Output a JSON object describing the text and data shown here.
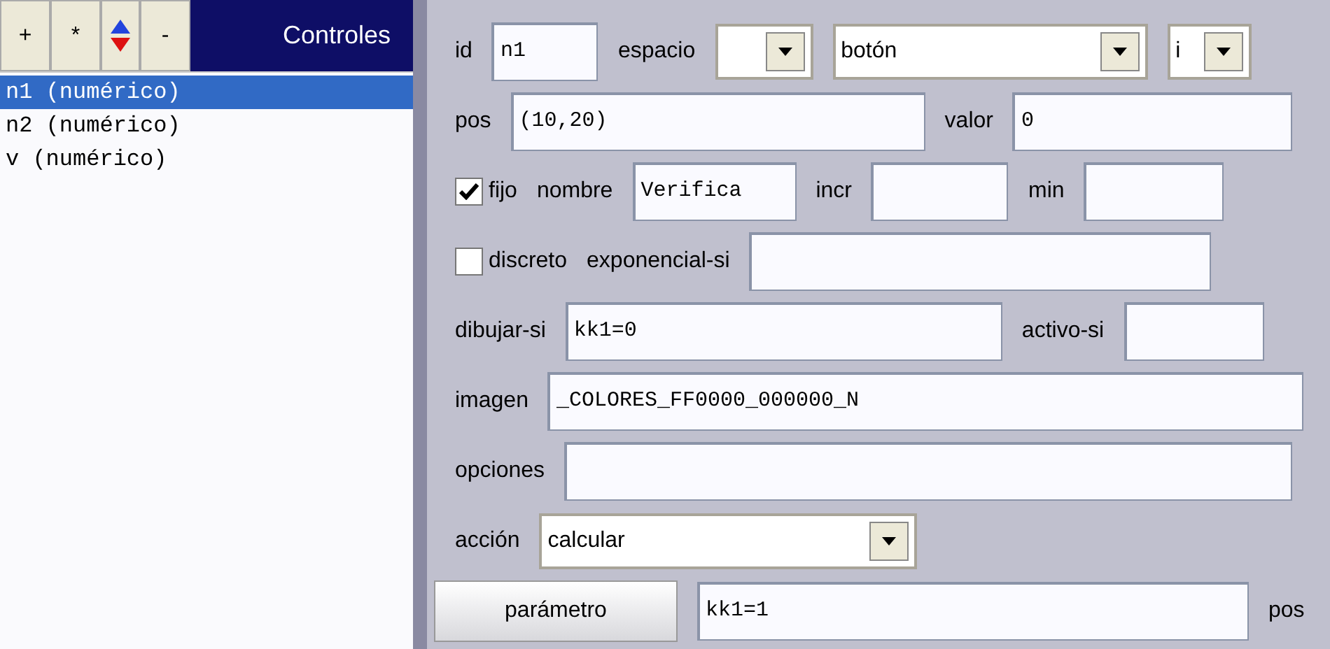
{
  "toolbar": {
    "buttons": [
      {
        "kind": "button",
        "label": "+"
      },
      {
        "kind": "button",
        "label": "*"
      },
      {
        "kind": "updown"
      },
      {
        "kind": "button",
        "label": "-"
      }
    ],
    "title": "Controles"
  },
  "controls_list": [
    {
      "label": "n1 (numérico)",
      "selected": true
    },
    {
      "label": "n2 (numérico)",
      "selected": false
    },
    {
      "label": "v (numérico)",
      "selected": false
    }
  ],
  "form_rows": [
    [
      {
        "kind": "label",
        "text": "id"
      },
      {
        "kind": "field",
        "value": "n1"
      },
      {
        "kind": "label",
        "text": "espacio"
      },
      {
        "kind": "select"
      },
      {
        "kind": "select",
        "value": "botón"
      },
      {
        "kind": "select",
        "value": "i"
      }
    ],
    [
      {
        "kind": "label",
        "text": "pos"
      },
      {
        "kind": "field",
        "value": "(10,20)"
      },
      {
        "kind": "label",
        "text": "valor"
      },
      {
        "kind": "field",
        "value": "0"
      }
    ],
    [
      {
        "kind": "checkbox",
        "text": "fijo",
        "checked": true
      },
      {
        "kind": "label",
        "text": "nombre"
      },
      {
        "kind": "field",
        "value": "Verifica"
      },
      {
        "kind": "label",
        "text": "incr"
      },
      {
        "kind": "field"
      },
      {
        "kind": "label",
        "text": "min"
      },
      {
        "kind": "field"
      }
    ],
    [
      {
        "kind": "checkbox",
        "text": "discreto",
        "checked": false
      },
      {
        "kind": "label",
        "text": "exponencial-si"
      },
      {
        "kind": "field"
      }
    ],
    [
      {
        "kind": "label",
        "text": "dibujar-si"
      },
      {
        "kind": "field",
        "value": "kk1=0"
      },
      {
        "kind": "label",
        "text": "activo-si"
      },
      {
        "kind": "field"
      }
    ],
    [
      {
        "kind": "label",
        "text": "imagen"
      },
      {
        "kind": "field",
        "value": "_COLORES_FF0000_000000_N"
      }
    ],
    [
      {
        "kind": "label",
        "text": "opciones"
      },
      {
        "kind": "field"
      }
    ],
    [
      {
        "kind": "label",
        "text": "acción"
      },
      {
        "kind": "select",
        "value": "calcular"
      }
    ],
    [
      {
        "kind": "button",
        "text": "parámetro"
      },
      {
        "kind": "field",
        "value": "kk1=1"
      },
      {
        "kind": "label",
        "text": "pos"
      }
    ]
  ]
}
